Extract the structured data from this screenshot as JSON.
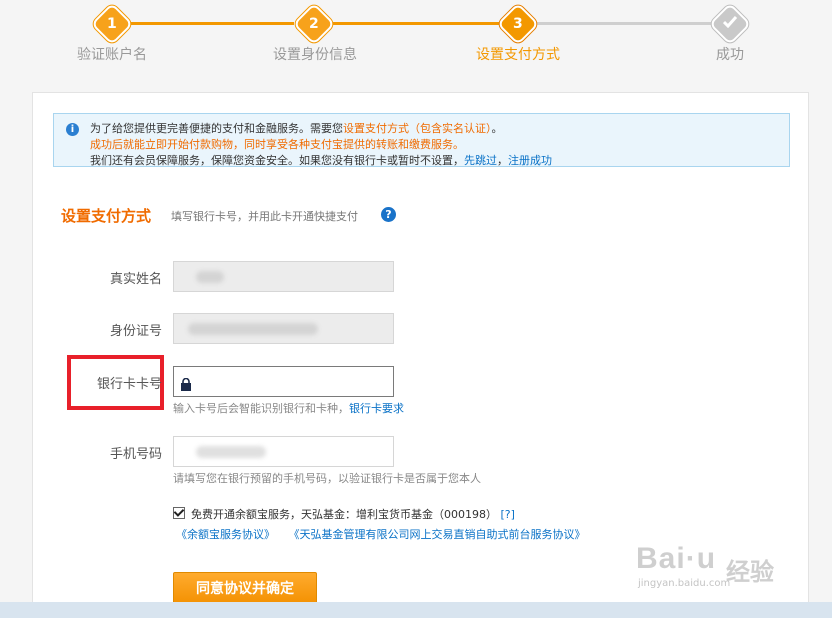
{
  "steps": [
    {
      "number": "1",
      "label": "验证账户名",
      "state": "done"
    },
    {
      "number": "2",
      "label": "设置身份信息",
      "state": "done"
    },
    {
      "number": "3",
      "label": "设置支付方式",
      "state": "current"
    },
    {
      "number": "",
      "label": "成功",
      "state": "todo",
      "icon": "check-icon"
    }
  ],
  "notice": {
    "line1_text": "为了给您提供更完善便捷的支付和金融服务。需要您",
    "line1_highlight": "设置支付方式（包含实名认证）",
    "line1_end": "。",
    "line2": "成功后就能立即开始付款购物，同时享受各种支付宝提供的转账和缴费服务。",
    "line3_text": "我们还有会员保障服务，保障您资金安全。如果您没有银行卡或暂时不设置，",
    "line3_link1": "先跳过",
    "line3_sep": "，",
    "line3_link2": "注册成功"
  },
  "section": {
    "title": "设置支付方式",
    "subtitle": "填写银行卡号，并用此卡开通快捷支付",
    "help_icon": "?"
  },
  "form": {
    "name_label": "真实姓名",
    "id_label": "身份证号",
    "card_label": "银行卡卡号",
    "card_hint": "输入卡号后会智能识别银行和卡种，",
    "card_hint_link": "银行卡要求",
    "phone_label": "手机号码",
    "phone_hint": "请填写您在银行预留的手机号码，以验证银行卡是否属于您本人"
  },
  "agreement": {
    "checked": true,
    "text": "免费开通余额宝服务，天弘基金：增利宝货币基金（000198）",
    "help_link": "[?]",
    "link1": "《余额宝服务协议》",
    "link2": "《天弘基金管理有限公司网上交易直销自助式前台服务协议》"
  },
  "submit_label": "同意协议并确定",
  "watermark": {
    "brand": "Bai",
    "brand_end": "u",
    "sub": "经验",
    "url": "jingyan.baidu.com"
  },
  "colors": {
    "accent": "#f39800",
    "link": "#0a72c7",
    "highlight_box": "#e8202a"
  }
}
